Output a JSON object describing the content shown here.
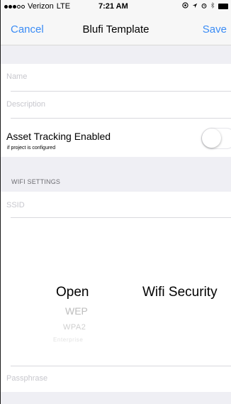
{
  "status_bar": {
    "carrier": "Verizon",
    "network": "LTE",
    "time": "7:21 AM",
    "icons": [
      "location-icon",
      "alarm-icon",
      "bluetooth-icon",
      "battery-icon"
    ]
  },
  "nav": {
    "cancel_label": "Cancel",
    "title": "Blufi Template",
    "save_label": "Save"
  },
  "form": {
    "name_placeholder": "Name",
    "description_placeholder": "Description",
    "asset_tracking_label": "Asset Tracking Enabled",
    "asset_tracking_sublabel": "if project is configured",
    "asset_tracking_enabled": false
  },
  "wifi": {
    "section_header": "WIFI SETTINGS",
    "ssid_placeholder": "SSID",
    "security_label": "Wifi Security",
    "security_options": [
      "Open",
      "WEP",
      "WPA2",
      "Enterprise"
    ],
    "selected_option": "Open",
    "passphrase_placeholder": "Passphrase"
  },
  "colors": {
    "accent": "#3b8cf5",
    "background": "#efeff4",
    "placeholder": "#c7c7cd"
  }
}
